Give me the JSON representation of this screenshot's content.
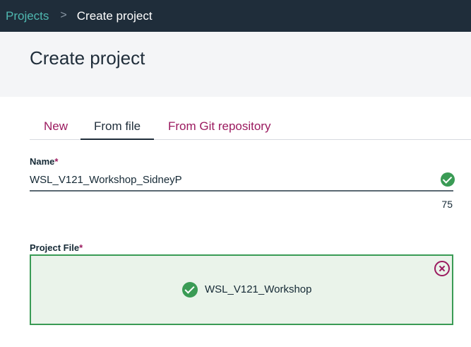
{
  "breadcrumb": {
    "parent": "Projects",
    "separator": ">",
    "current": "Create project"
  },
  "header": {
    "title": "Create project"
  },
  "tabs": [
    {
      "label": "New",
      "selected": false
    },
    {
      "label": "From file",
      "selected": true
    },
    {
      "label": "From Git repository",
      "selected": false
    }
  ],
  "name_field": {
    "label": "Name",
    "required_mark": "*",
    "value": "WSL_V121_Workshop_SidneyP",
    "status_icon": "check-circle-icon",
    "remaining_chars": "75"
  },
  "project_file": {
    "label": "Project File",
    "required_mark": "*",
    "file_name": "WSL_V121_Workshop",
    "status_icon": "check-circle-icon",
    "remove_icon": "close-circle-icon"
  },
  "colors": {
    "topbar": "#1f2d3a",
    "link": "#4fb8b0",
    "accent": "#9b1a5f",
    "success": "#3a9b55",
    "dropzone_bg": "#eaf3ea"
  }
}
